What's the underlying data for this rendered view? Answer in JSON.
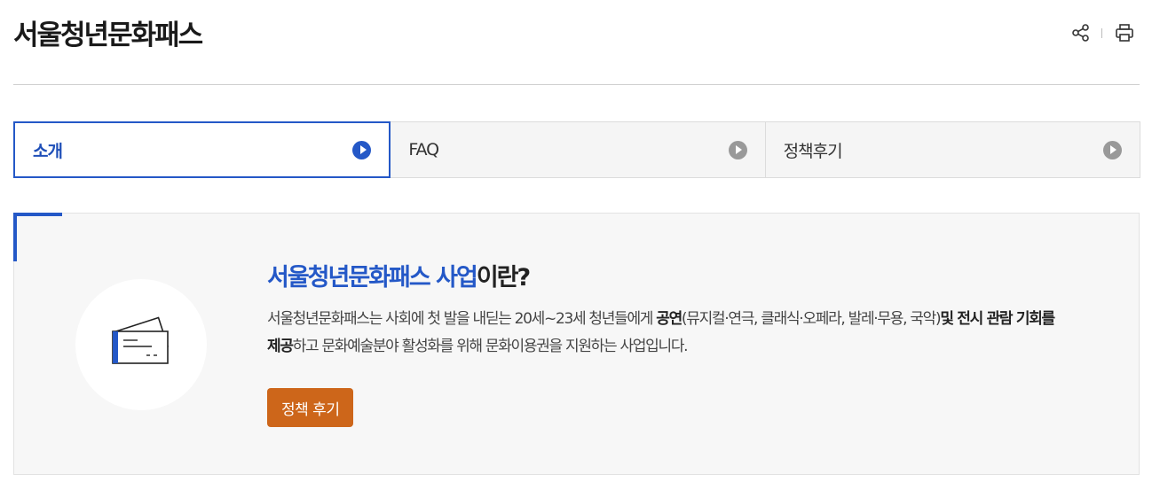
{
  "header": {
    "title": "서울청년문화패스",
    "tools": [
      {
        "icon": "share-icon"
      },
      {
        "icon": "print-icon"
      }
    ]
  },
  "tabs": [
    {
      "label": "소개",
      "active": true,
      "icon": "play-circle-icon"
    },
    {
      "label": "FAQ",
      "active": false,
      "icon": "play-circle-icon"
    },
    {
      "label": "정책후기",
      "active": false,
      "icon": "play-circle-icon"
    }
  ],
  "intro": {
    "title_highlight": "서울청년문화패스 사업",
    "title_rest": "이란?",
    "desc_part1": "서울청년문화패스는 사회에 첫 발을 내딛는 20세~23세 청년들에게 ",
    "desc_bold1": "공연",
    "desc_part2": "(뮤지컬·연극, 클래식·오페라, 발레·무용, 국악)",
    "desc_bold2": "및 전시 관람 기회를 제공",
    "desc_part3": "하고 문화예술분야 활성화를 위해 문화이용권을 지원하는 사업입니다.",
    "button_label": "정책 후기",
    "illustration_icon": "ticket-icon"
  },
  "colors": {
    "accent": "#2458c7",
    "button": "#cd661a",
    "tab_inactive_icon": "#999999",
    "box_bg": "#f7f7f7"
  }
}
